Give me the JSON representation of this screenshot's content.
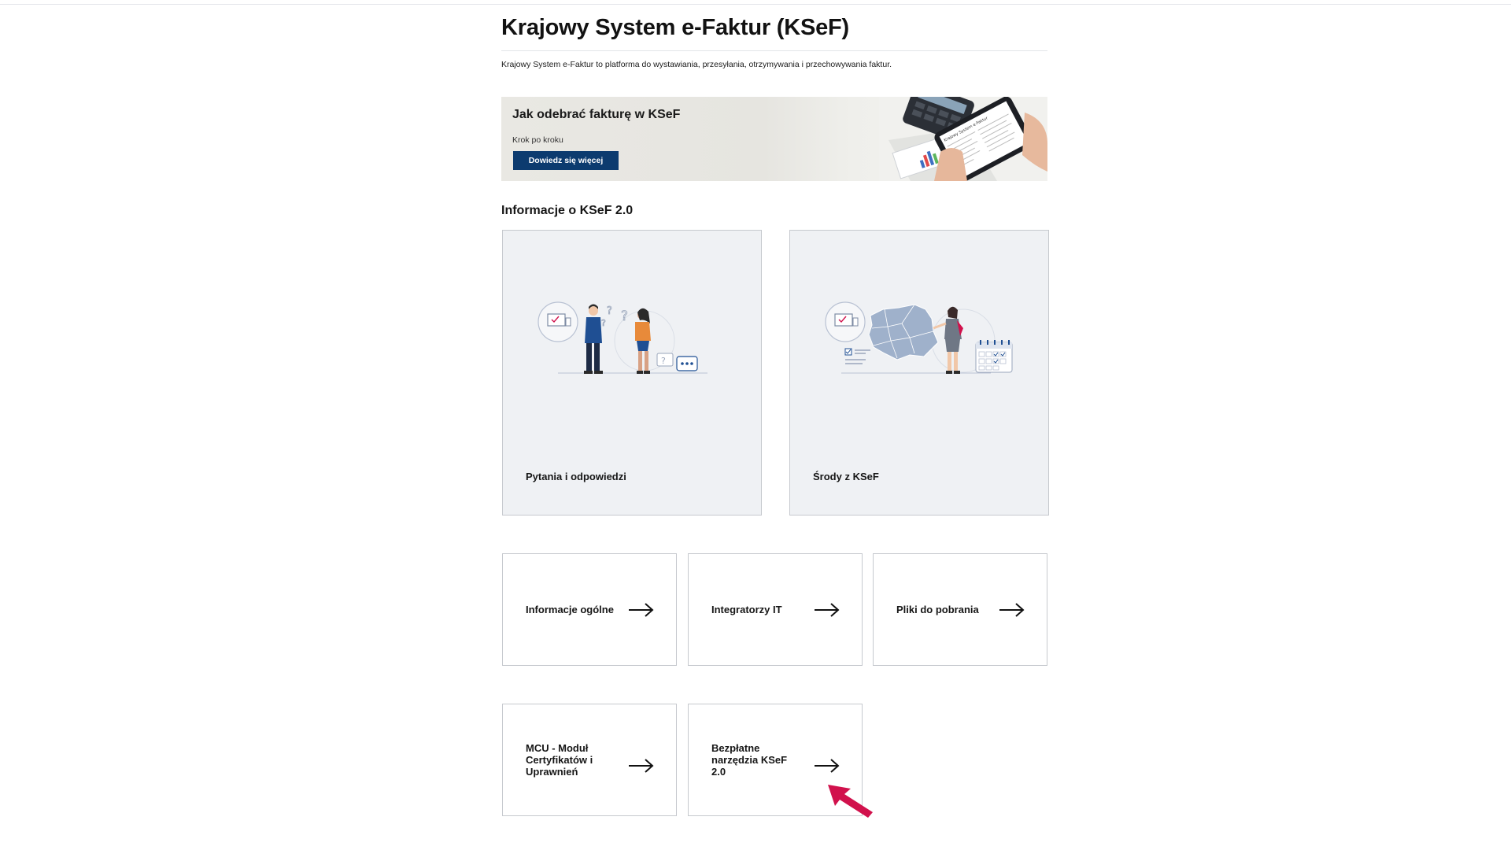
{
  "page": {
    "title": "Krajowy System e-Faktur (KSeF)",
    "subtitle": "Krajowy System e-Faktur to platforma do wystawiania, przesyłania, otrzymywania i przechowywania faktur."
  },
  "banner": {
    "title": "Jak odebrać fakturę w KSeF",
    "subtitle": "Krok po kroku",
    "button_label": "Dowiedz się więcej",
    "screen_text": "Krajowy System e-Faktur"
  },
  "section": {
    "title": "Informacje o KSeF 2.0"
  },
  "cards": [
    {
      "label": "Pytania i odpowiedzi",
      "illustration": "people-questions-illustration"
    },
    {
      "label": "Środy z KSeF",
      "illustration": "poland-map-presenter-illustration"
    }
  ],
  "tiles": [
    {
      "label": "Informacje ogólne"
    },
    {
      "label": "Integratorzy IT"
    },
    {
      "label": "Pliki do pobrania"
    },
    {
      "label": "MCU - Moduł Certyfikatów i Uprawnień"
    },
    {
      "label": "Bezpłatne narzędzia KSeF 2.0"
    }
  ],
  "icons": {
    "tile_arrow": "arrow-right-icon",
    "pointer": "red-pointer-arrow-icon"
  },
  "colors": {
    "button_bg": "#0c3b6f",
    "card_bg": "#eff1f4",
    "pointer": "#d1114c",
    "illustration_blue": "#1f4f93"
  }
}
